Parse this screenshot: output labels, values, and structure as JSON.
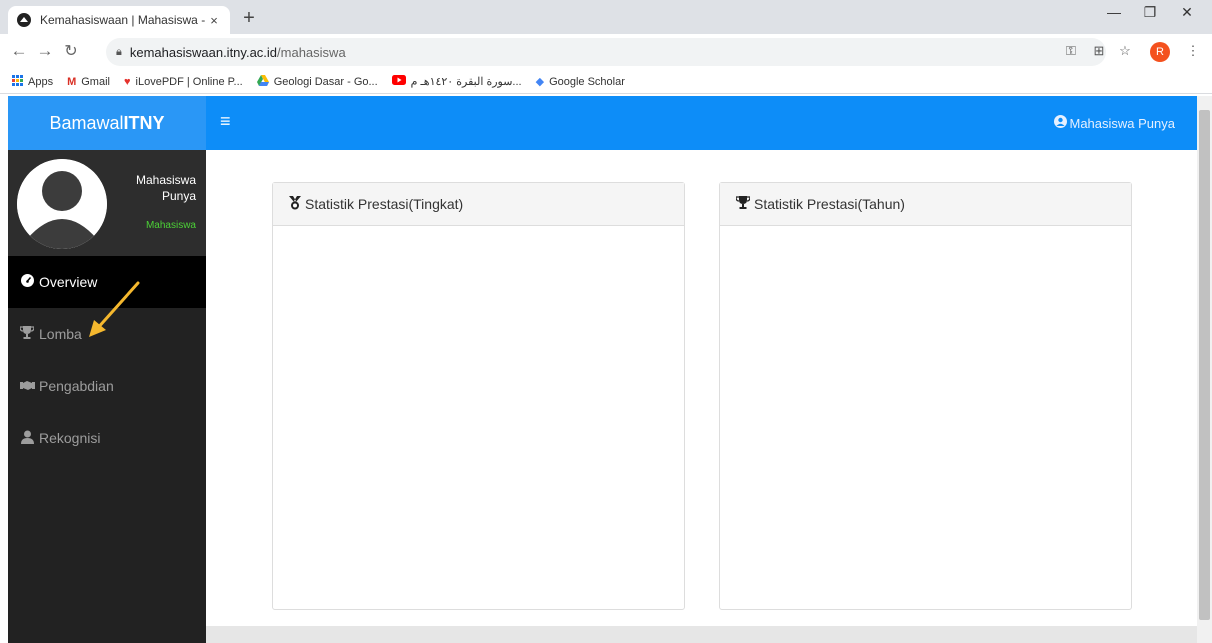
{
  "browser": {
    "tab_title": "Kemahasiswaan | Mahasiswa -",
    "tab_close": "×",
    "new_tab": "+",
    "url_host": "kemahasiswaan.itny.ac.id",
    "url_path": "/mahasiswa",
    "profile_initial": "R",
    "bookmarks": [
      {
        "label": "Apps",
        "icon": "apps-grid-icon"
      },
      {
        "label": "Gmail",
        "icon": "gmail-icon"
      },
      {
        "label": "iLovePDF | Online P...",
        "icon": "ilovepdf-icon"
      },
      {
        "label": "Geologi Dasar - Go...",
        "icon": "google-drive-icon"
      },
      {
        "label": "سورة البقرة ١٤٢٠هـ م...",
        "icon": "youtube-icon"
      },
      {
        "label": "Google Scholar",
        "icon": "scholar-icon"
      }
    ]
  },
  "header": {
    "brand_prefix": "Bamawal",
    "brand_bold": "TNY",
    "brand_i": "I",
    "user_name": "Mahasiswa Punya"
  },
  "sidebar": {
    "profile_name_line1": "Mahasiswa",
    "profile_name_line2": "Punya",
    "profile_role": "Mahasiswa",
    "items": [
      {
        "label": "Overview",
        "icon": "dashboard-icon",
        "active": true
      },
      {
        "label": "Lomba",
        "icon": "trophy-icon",
        "active": false
      },
      {
        "label": "Pengabdian",
        "icon": "handshake-icon",
        "active": false
      },
      {
        "label": "Rekognisi",
        "icon": "user-certificate-icon",
        "active": false
      }
    ]
  },
  "panels": [
    {
      "title": "Statistik Prestasi(Tingkat)",
      "icon": "medal-icon"
    },
    {
      "title": "Statistik Prestasi(Tahun)",
      "icon": "trophy-icon"
    }
  ],
  "colors": {
    "header_blue": "#0d8df8",
    "brand_blue": "#2a97f6",
    "sidebar_dark": "#222222",
    "role_green": "#4cd137",
    "arrow_orange": "#f5b82e"
  }
}
